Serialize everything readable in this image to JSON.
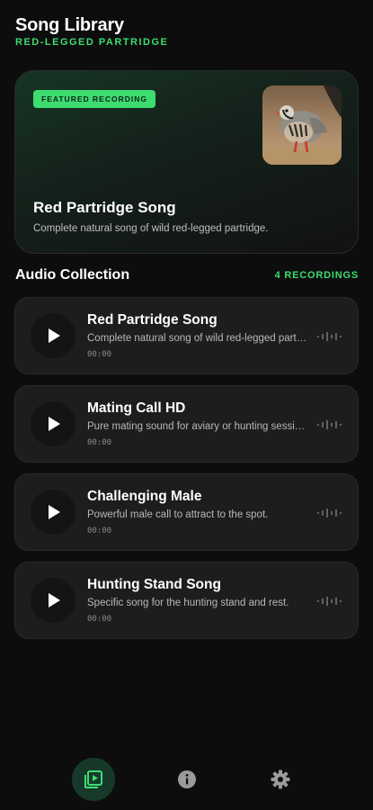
{
  "header": {
    "title": "Song Library",
    "subtitle": "RED-LEGGED PARTRIDGE"
  },
  "featured": {
    "badge": "FEATURED RECORDING",
    "title": "Red Partridge Song",
    "description": "Complete natural song of wild red-legged partridge.",
    "image_icon": "partridge-photo"
  },
  "collection": {
    "title": "Audio Collection",
    "count_label": "4 RECORDINGS",
    "tracks": [
      {
        "title": "Red Partridge Song",
        "description": "Complete natural song of wild red-legged partridge.",
        "time": "00:00"
      },
      {
        "title": "Mating Call HD",
        "description": "Pure mating sound for aviary or hunting sessions.",
        "time": "00:00"
      },
      {
        "title": "Challenging Male",
        "description": "Powerful male call to attract to the spot.",
        "time": "00:00"
      },
      {
        "title": "Hunting Stand Song",
        "description": "Specific song for the hunting stand and rest.",
        "time": "00:00"
      }
    ]
  },
  "nav": {
    "items": [
      {
        "icon": "playlist-play-icon",
        "active": true
      },
      {
        "icon": "info-icon",
        "active": false
      },
      {
        "icon": "gear-icon",
        "active": false
      }
    ]
  },
  "colors": {
    "accent": "#3ddc71",
    "background": "#0d0d0d",
    "card": "#1d1d1d"
  }
}
